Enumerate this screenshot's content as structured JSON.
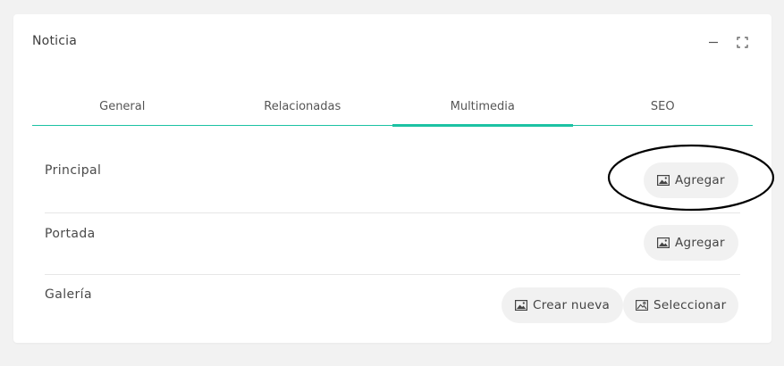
{
  "card": {
    "title": "Noticia",
    "tools": {
      "minimize_icon": "minimize-icon",
      "expand_icon": "expand-icon"
    }
  },
  "tabs": [
    {
      "label": "General",
      "active": false
    },
    {
      "label": "Relacionadas",
      "active": false
    },
    {
      "label": "Multimedia",
      "active": true
    },
    {
      "label": "SEO",
      "active": false
    }
  ],
  "sections": {
    "principal": {
      "label": "Principal",
      "add_label": "Agregar"
    },
    "portada": {
      "label": "Portada",
      "add_label": "Agregar"
    },
    "galeria": {
      "label": "Galería",
      "create_label": "Crear nueva",
      "select_label": "Seleccionar"
    }
  },
  "colors": {
    "accent": "#1cc2a3",
    "pill_bg": "#f1f1f1",
    "page_bg": "#f2f2f2"
  }
}
